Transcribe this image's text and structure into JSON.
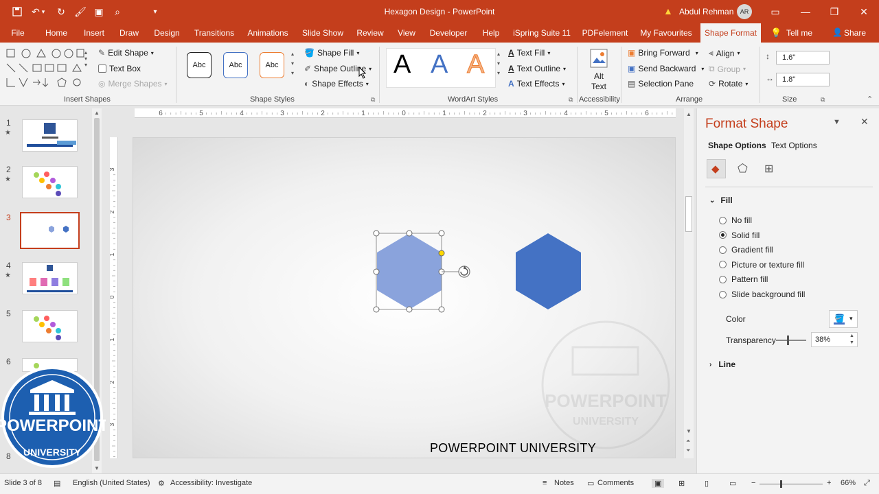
{
  "titlebar": {
    "title": "Hexagon Design  -  PowerPoint",
    "user_name": "Abdul Rehman",
    "user_initials": "AR",
    "icons": [
      "save-icon",
      "undo-icon",
      "redo-icon",
      "format-painter-icon",
      "picture-icon",
      "preview-icon",
      "customize-icon"
    ]
  },
  "tabs": [
    "File",
    "Home",
    "Insert",
    "Draw",
    "Design",
    "Transitions",
    "Animations",
    "Slide Show",
    "Review",
    "View",
    "Developer",
    "Help",
    "iSpring Suite 11",
    "PDFelement",
    "My Favourites",
    "Shape Format",
    "Tell me",
    "Share"
  ],
  "active_tab": "Shape Format",
  "ribbon": {
    "insert_shapes": {
      "edit_shape": "Edit Shape",
      "text_box": "Text Box",
      "merge_shapes": "Merge Shapes",
      "label": "Insert Shapes"
    },
    "shape_styles": {
      "swatches": [
        "Abc",
        "Abc",
        "Abc"
      ],
      "shape_fill": "Shape Fill",
      "shape_outline": "Shape Outline",
      "shape_effects": "Shape Effects",
      "label": "Shape Styles"
    },
    "wordart_styles": {
      "letters": [
        "A",
        "A",
        "A"
      ],
      "text_fill": "Text Fill",
      "text_outline": "Text Outline",
      "text_effects": "Text Effects",
      "label": "WordArt Styles"
    },
    "accessibility": {
      "alt_text_1": "Alt",
      "alt_text_2": "Text",
      "label": "Accessibility"
    },
    "arrange": {
      "bring_forward": "Bring Forward",
      "send_backward": "Send Backward",
      "selection_pane": "Selection Pane",
      "align": "Align",
      "group": "Group",
      "rotate": "Rotate",
      "label": "Arrange"
    },
    "size": {
      "height": "1.6\"",
      "width": "1.8\"",
      "label": "Size"
    }
  },
  "slides_panel": {
    "numbers": [
      "1",
      "2",
      "3",
      "4",
      "5",
      "6",
      "8"
    ],
    "selected": "3"
  },
  "ruler": {
    "h_labels": [
      "6",
      "5",
      "4",
      "3",
      "2",
      "1",
      "0",
      "1",
      "2",
      "3",
      "4",
      "5",
      "6"
    ],
    "v_labels": [
      "3",
      "2",
      "1",
      "0",
      "1",
      "2",
      "3"
    ]
  },
  "slide": {
    "footer_text": "POWERPOINT UNIVERSITY",
    "watermark_1": "POWERPOINT",
    "watermark_2": "UNIVERSITY"
  },
  "logo": {
    "line1": "POWERPOINT",
    "line2": "UNIVERSITY"
  },
  "format_pane": {
    "title": "Format Shape",
    "tab_shape": "Shape Options",
    "tab_text": "Text Options",
    "fill_heading": "Fill",
    "options": [
      "No fill",
      "Solid fill",
      "Gradient fill",
      "Picture or texture fill",
      "Pattern fill",
      "Slide background fill"
    ],
    "selected_option": "Solid fill",
    "color_label": "Color",
    "transparency_label": "Transparency",
    "transparency_value": "38%",
    "transparency_fraction": 0.38,
    "line_heading": "Line"
  },
  "statusbar": {
    "slide_info": "Slide 3 of 8",
    "language": "English (United States)",
    "accessibility": "Accessibility: Investigate",
    "notes": "Notes",
    "comments": "Comments",
    "zoom": "66%"
  },
  "colors": {
    "accent": "#c43e1c",
    "hex_light": "#8aa3dc",
    "hex_dark": "#4472c4"
  }
}
